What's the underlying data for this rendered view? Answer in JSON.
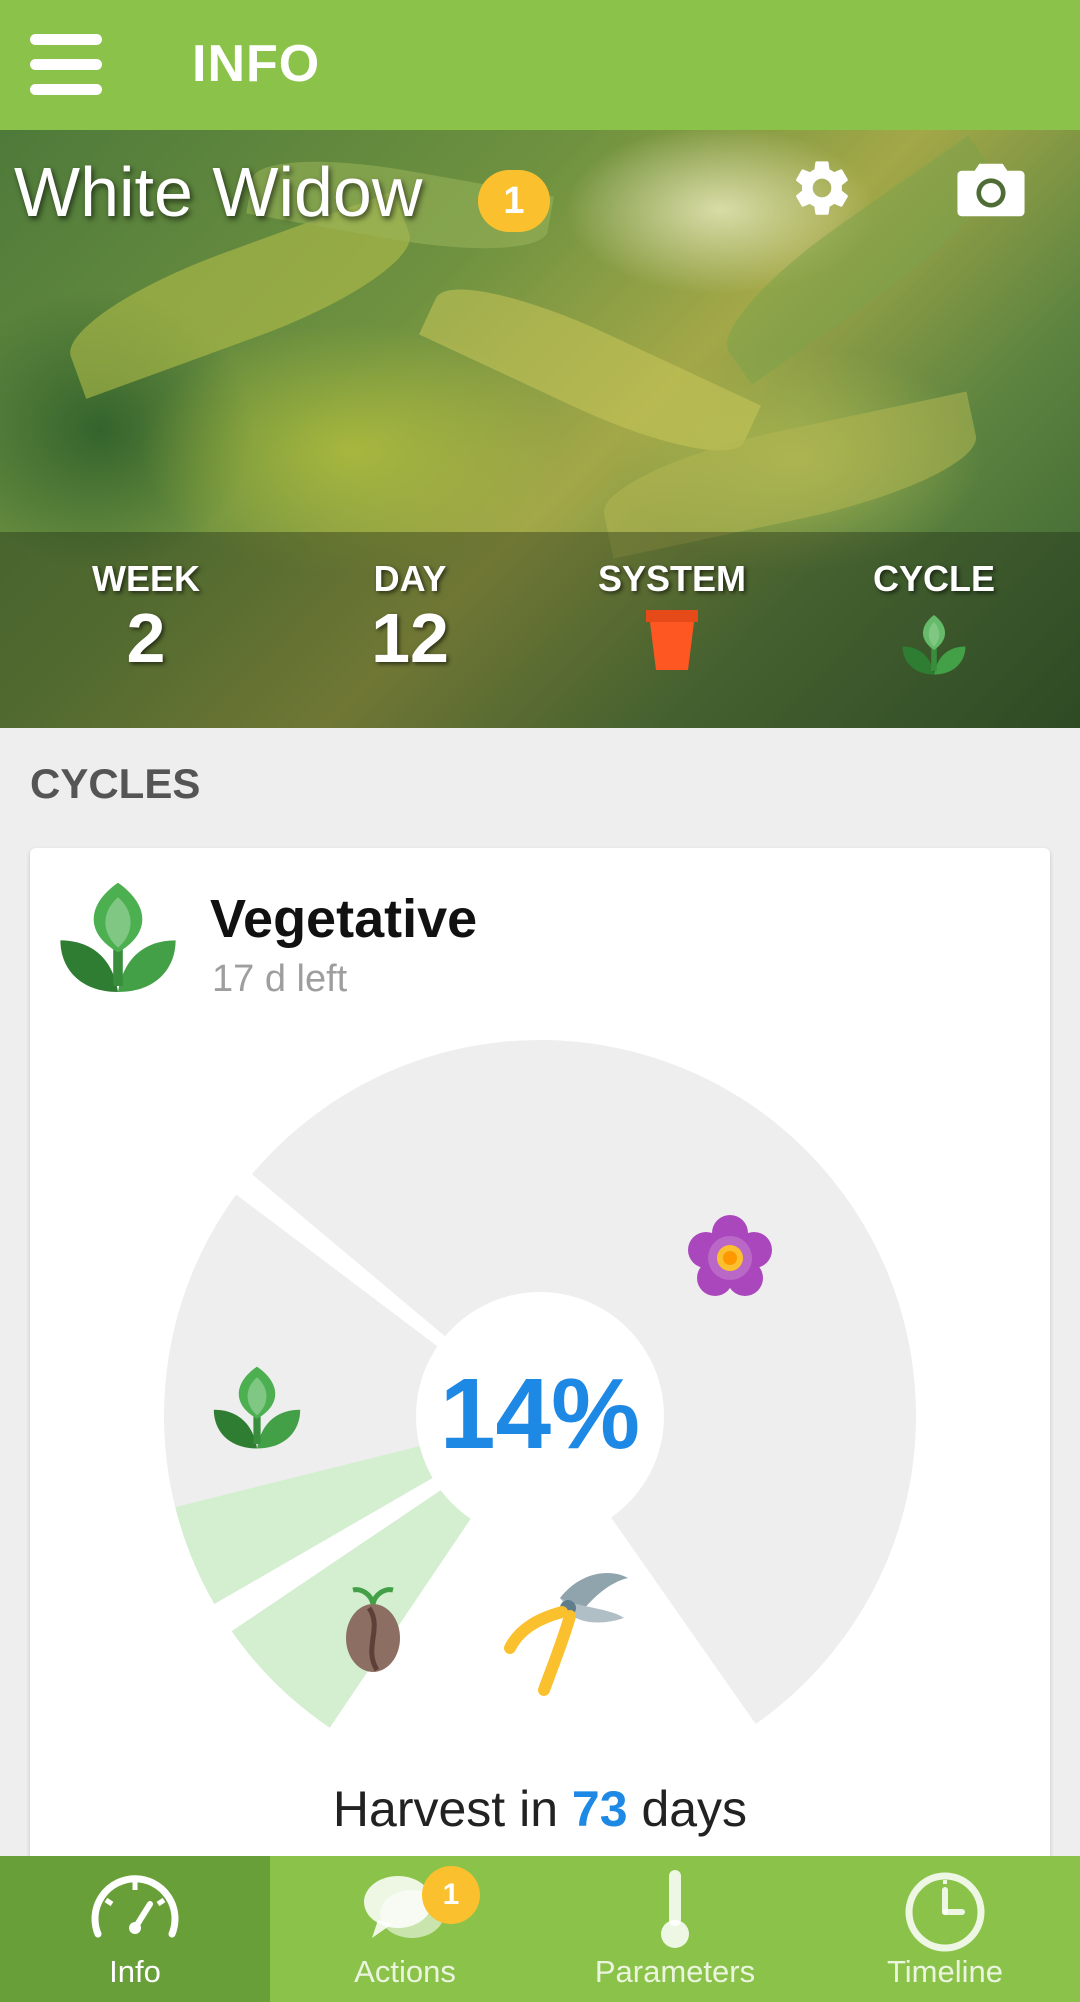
{
  "app_bar": {
    "title": "INFO",
    "menu_icon": "hamburger-menu-icon",
    "background_color": "#8bc34a"
  },
  "plant": {
    "name": "White Widow",
    "notification_count": "1",
    "settings_icon": "gear-icon",
    "camera_icon": "camera-icon"
  },
  "stats": [
    {
      "label": "WEEK",
      "value": "2"
    },
    {
      "label": "DAY",
      "value": "12"
    },
    {
      "label": "SYSTEM",
      "icon": "flower-pot-icon"
    },
    {
      "label": "CYCLE",
      "icon": "vegetative-plant-icon"
    }
  ],
  "cycles_section": {
    "title": "CYCLES",
    "current_cycle": {
      "name": "Vegetative",
      "time_left": "17 d left",
      "icon": "vegetative-plant-icon"
    },
    "progress_percent": "14%",
    "progress_fraction": 0.14,
    "stages": [
      {
        "name": "germination",
        "icon": "seed-icon",
        "state": "completed"
      },
      {
        "name": "vegetative",
        "icon": "vegetative-plant-icon",
        "state": "current"
      },
      {
        "name": "flowering",
        "icon": "flower-icon",
        "state": "upcoming"
      },
      {
        "name": "harvest",
        "icon": "pruning-shears-icon",
        "state": "upcoming"
      }
    ],
    "harvest": {
      "prefix": "Harvest in",
      "days": "73",
      "suffix": "days"
    }
  },
  "bottom_nav": [
    {
      "label": "Info",
      "icon": "speedometer-icon",
      "active": true
    },
    {
      "label": "Actions",
      "icon": "chat-bubbles-icon",
      "badge": "1",
      "active": false
    },
    {
      "label": "Parameters",
      "icon": "thermometer-icon",
      "active": false
    },
    {
      "label": "Timeline",
      "icon": "clock-icon",
      "active": false
    }
  ],
  "colors": {
    "primary_green": "#8bc34a",
    "active_tab_green": "#689f38",
    "badge_yellow": "#fbc02d",
    "accent_blue": "#1e88e5"
  }
}
